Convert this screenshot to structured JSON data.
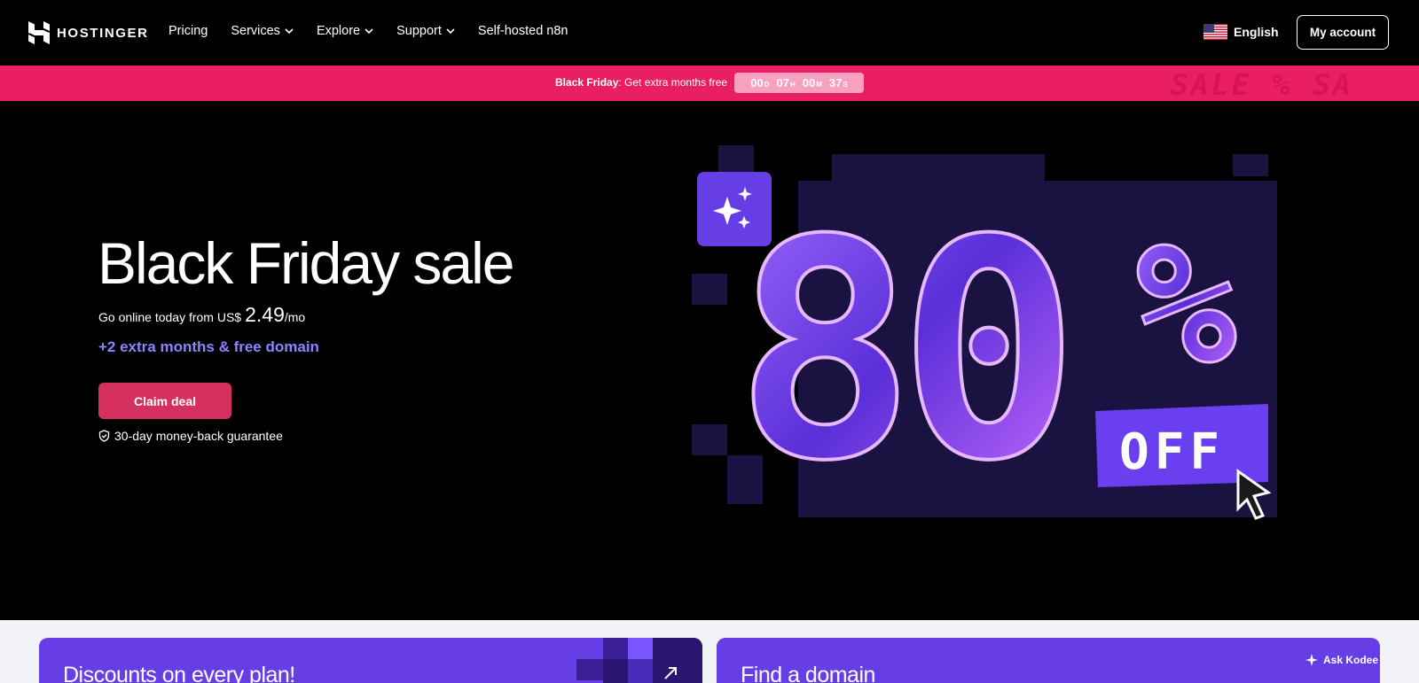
{
  "brand": {
    "name": "HOSTINGER"
  },
  "nav": {
    "items": [
      {
        "label": "Pricing",
        "dropdown": false
      },
      {
        "label": "Services",
        "dropdown": true
      },
      {
        "label": "Explore",
        "dropdown": true
      },
      {
        "label": "Support",
        "dropdown": true
      },
      {
        "label": "Self-hosted n8n",
        "dropdown": false
      }
    ],
    "language": "English",
    "account_label": "My account"
  },
  "promo": {
    "bold": "Black Friday",
    "text": ": Get extra months free",
    "timer": {
      "days": "00",
      "hours": "07",
      "minutes": "00",
      "seconds": "37",
      "d": "D",
      "h": "H",
      "m": "M",
      "s": "S"
    },
    "decor": "SALE  %  SA"
  },
  "hero": {
    "title": "Black Friday sale",
    "price_prefix": "Go online today from US$",
    "price": "2.49",
    "price_suffix": "/mo",
    "extra": "+2 extra months & free domain",
    "cta": "Claim deal",
    "guarantee": "30-day money-back guarantee",
    "art": {
      "discount": "80%",
      "off": "OFF"
    }
  },
  "cards": [
    {
      "title": "Discounts on every plan!"
    },
    {
      "title": "Find a domain"
    }
  ],
  "chat": {
    "label": "Ask Kodee"
  },
  "colors": {
    "promo": "#ea1e63",
    "accent": "#673de6",
    "cta": "#d5305f",
    "highlight": "#8c85ff"
  }
}
